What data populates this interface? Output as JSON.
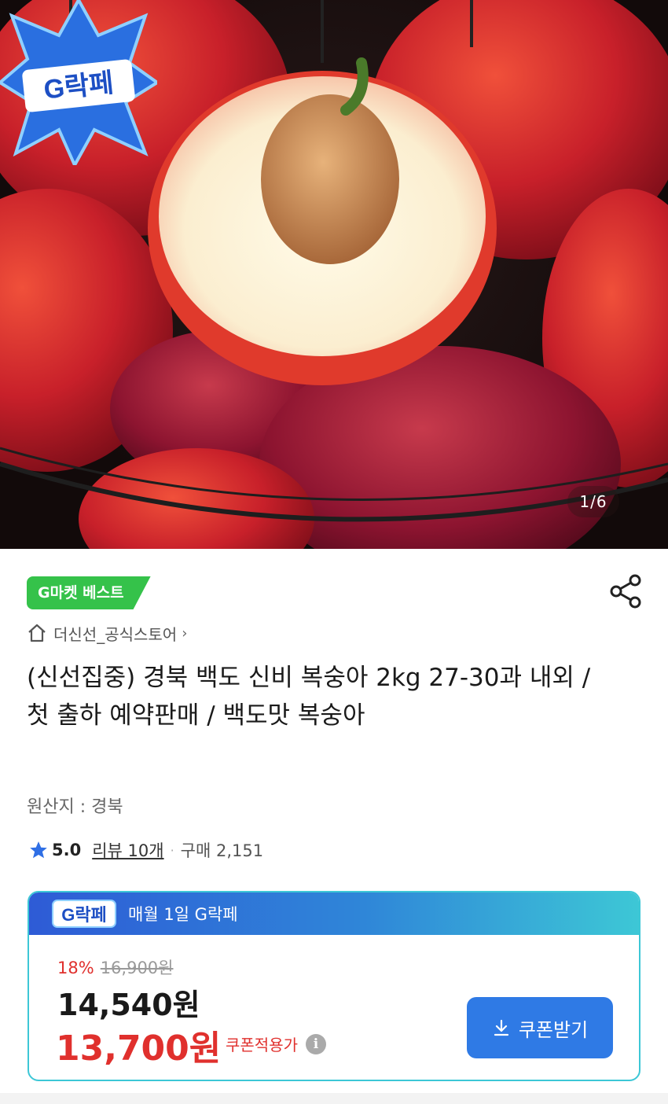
{
  "hero": {
    "image_counter": "1/6",
    "badge_text": "G락페"
  },
  "product": {
    "best_badge": "G마켓 베스트",
    "store_name": "더신선_공식스토어",
    "title": "(신선집중) 경북 백도 신비 복숭아 2kg 27-30과 내외 / 첫 출하 예약판매 / 백도맛 복숭아",
    "origin": "원산지 : 경북",
    "rating": "5.0",
    "review_link": "리뷰 10개",
    "purchase_count": "구매 2,151"
  },
  "deal": {
    "logo_text": "G락페",
    "header_text": "매월 1일 G락페",
    "discount_rate": "18%",
    "original_price": "16,900원",
    "price": "14,540원",
    "coupon_price": "13,700원",
    "coupon_note": "쿠폰적용가",
    "coupon_button": "쿠폰받기"
  },
  "colors": {
    "best_green": "#35c24a",
    "price_red": "#e0302d",
    "coupon_blue": "#2f7ae5",
    "deal_gradient_start": "#2e5bd6",
    "deal_gradient_end": "#3dc7d6"
  },
  "icons": [
    "share-icon",
    "home-icon",
    "chevron-right-icon",
    "star-icon",
    "info-icon",
    "download-icon"
  ]
}
